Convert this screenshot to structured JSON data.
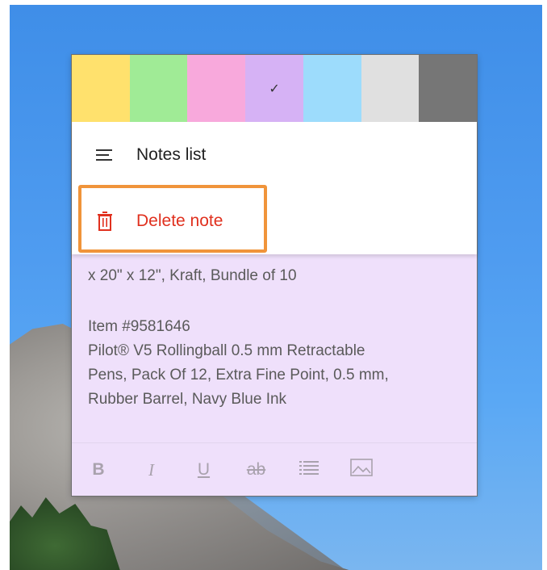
{
  "palette": {
    "colors": [
      "#ffe16d",
      "#a0eb96",
      "#f8a9dc",
      "#d6b2f5",
      "#9ddcfc",
      "#e0e0e0",
      "#767676"
    ],
    "selected_index": 3,
    "check_glyph": "✓"
  },
  "menu": {
    "notes_list_label": "Notes list",
    "notes_list_icon": "hamburger-icon",
    "delete_label": "Delete note",
    "delete_icon": "trash-icon"
  },
  "note": {
    "line1": "x 20\" x 12\", Kraft, Bundle of 10",
    "line2": "Item #9581646",
    "line3": "Pilot® V5 Rollingball 0.5 mm Retractable",
    "line4": "Pens, Pack Of 12, Extra Fine Point, 0.5 mm,",
    "line5": "Rubber Barrel, Navy Blue Ink"
  },
  "toolbar": {
    "bold": "B",
    "italic": "I",
    "underline": "U",
    "strike": "ab",
    "list_icon": "list-icon",
    "image_icon": "image-icon"
  },
  "accent": {
    "highlight": "#f0943a",
    "delete": "#e0301e"
  }
}
